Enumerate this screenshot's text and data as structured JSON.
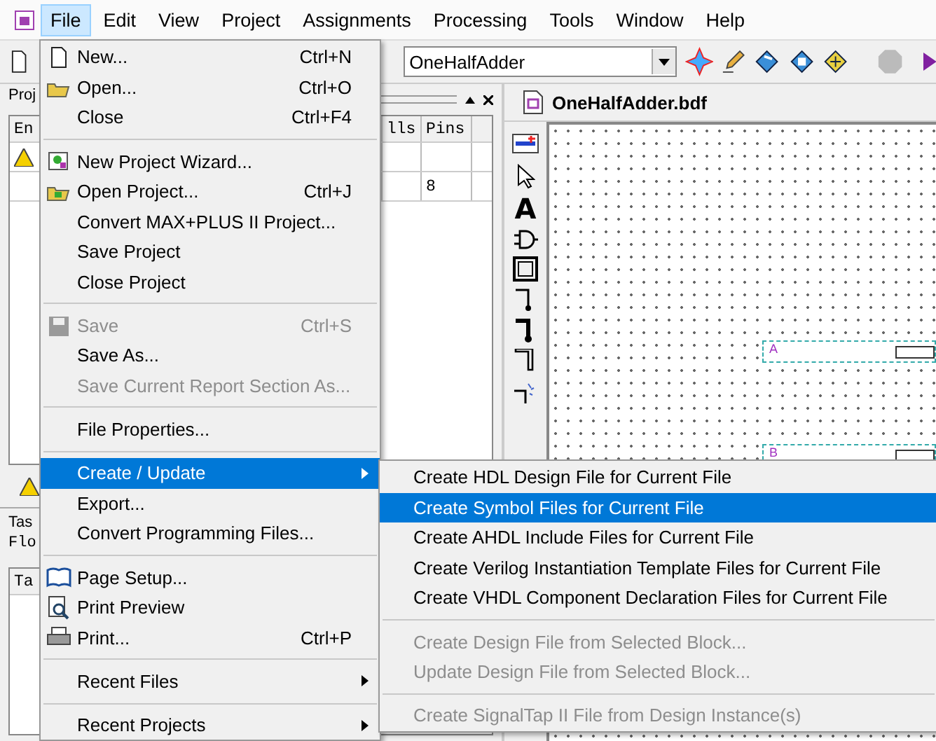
{
  "menubar": [
    {
      "label": "File",
      "selected": true
    },
    {
      "label": "Edit",
      "selected": false
    },
    {
      "label": "View",
      "selected": false
    },
    {
      "label": "Project",
      "selected": false
    },
    {
      "label": "Assignments",
      "selected": false
    },
    {
      "label": "Processing",
      "selected": false
    },
    {
      "label": "Tools",
      "selected": false
    },
    {
      "label": "Window",
      "selected": false
    },
    {
      "label": "Help",
      "selected": false
    }
  ],
  "toolbar": {
    "project": "OneHalfAdder"
  },
  "project_panel": {
    "title": "Proj",
    "columns": [
      "En",
      "lls",
      "Pins"
    ],
    "rows": [
      {
        "kind": "warning"
      },
      {
        "kind": "text",
        "pins": "8"
      }
    ]
  },
  "tasks_panel": {
    "title": "Tas",
    "flow": "Flo",
    "column": "Ta"
  },
  "document": {
    "title": "OneHalfAdder.bdf",
    "text_tool": "A",
    "pins": [
      {
        "label": "A"
      },
      {
        "label": "B"
      }
    ]
  },
  "file_menu": [
    {
      "kind": "item",
      "label": "New...",
      "shortcut": "Ctrl+N",
      "disabled": false,
      "selected": false
    },
    {
      "kind": "item",
      "label": "Open...",
      "shortcut": "Ctrl+O",
      "disabled": false,
      "selected": false
    },
    {
      "kind": "item",
      "label": "Close",
      "shortcut": "Ctrl+F4",
      "disabled": false,
      "selected": false
    },
    {
      "kind": "separator"
    },
    {
      "kind": "item",
      "label": "New Project Wizard...",
      "disabled": false,
      "selected": false
    },
    {
      "kind": "item",
      "label": "Open Project...",
      "shortcut": "Ctrl+J",
      "disabled": false,
      "selected": false
    },
    {
      "kind": "item",
      "label": "Convert MAX+PLUS II Project...",
      "disabled": false,
      "selected": false
    },
    {
      "kind": "item",
      "label": "Save Project",
      "disabled": false,
      "selected": false
    },
    {
      "kind": "item",
      "label": "Close Project",
      "disabled": false,
      "selected": false
    },
    {
      "kind": "separator"
    },
    {
      "kind": "item",
      "label": "Save",
      "shortcut": "Ctrl+S",
      "disabled": true,
      "selected": false
    },
    {
      "kind": "item",
      "label": "Save As...",
      "disabled": false,
      "selected": false
    },
    {
      "kind": "item",
      "label": "Save Current Report Section As...",
      "disabled": true,
      "selected": false
    },
    {
      "kind": "separator"
    },
    {
      "kind": "item",
      "label": "File Properties...",
      "disabled": false,
      "selected": false
    },
    {
      "kind": "separator"
    },
    {
      "kind": "submenu",
      "label": "Create / Update",
      "disabled": false,
      "selected": true
    },
    {
      "kind": "item",
      "label": "Export...",
      "disabled": false,
      "selected": false
    },
    {
      "kind": "item",
      "label": "Convert Programming Files...",
      "disabled": false,
      "selected": false
    },
    {
      "kind": "separator"
    },
    {
      "kind": "item",
      "label": "Page Setup...",
      "disabled": false,
      "selected": false
    },
    {
      "kind": "item",
      "label": "Print Preview",
      "disabled": false,
      "selected": false
    },
    {
      "kind": "item",
      "label": "Print...",
      "shortcut": "Ctrl+P",
      "disabled": false,
      "selected": false
    },
    {
      "kind": "separator"
    },
    {
      "kind": "submenu",
      "label": "Recent Files",
      "disabled": false,
      "selected": false
    },
    {
      "kind": "separator"
    },
    {
      "kind": "submenu",
      "label": "Recent Projects",
      "disabled": false,
      "selected": false
    }
  ],
  "create_update_submenu": [
    {
      "kind": "item",
      "label": "Create HDL Design File for Current File",
      "disabled": false,
      "selected": false
    },
    {
      "kind": "item",
      "label": "Create Symbol Files for Current File",
      "disabled": false,
      "selected": true
    },
    {
      "kind": "item",
      "label": "Create AHDL Include Files for Current File",
      "disabled": false,
      "selected": false
    },
    {
      "kind": "item",
      "label": "Create Verilog Instantiation Template Files for Current File",
      "disabled": false,
      "selected": false
    },
    {
      "kind": "item",
      "label": "Create VHDL Component Declaration Files for Current File",
      "disabled": false,
      "selected": false
    },
    {
      "kind": "separator"
    },
    {
      "kind": "item",
      "label": "Create Design File from Selected Block...",
      "disabled": true,
      "selected": false
    },
    {
      "kind": "item",
      "label": "Update Design File from Selected Block...",
      "disabled": true,
      "selected": false
    },
    {
      "kind": "separator"
    },
    {
      "kind": "item",
      "label": "Create SignalTap II File from Design Instance(s)",
      "disabled": true,
      "selected": false
    }
  ]
}
